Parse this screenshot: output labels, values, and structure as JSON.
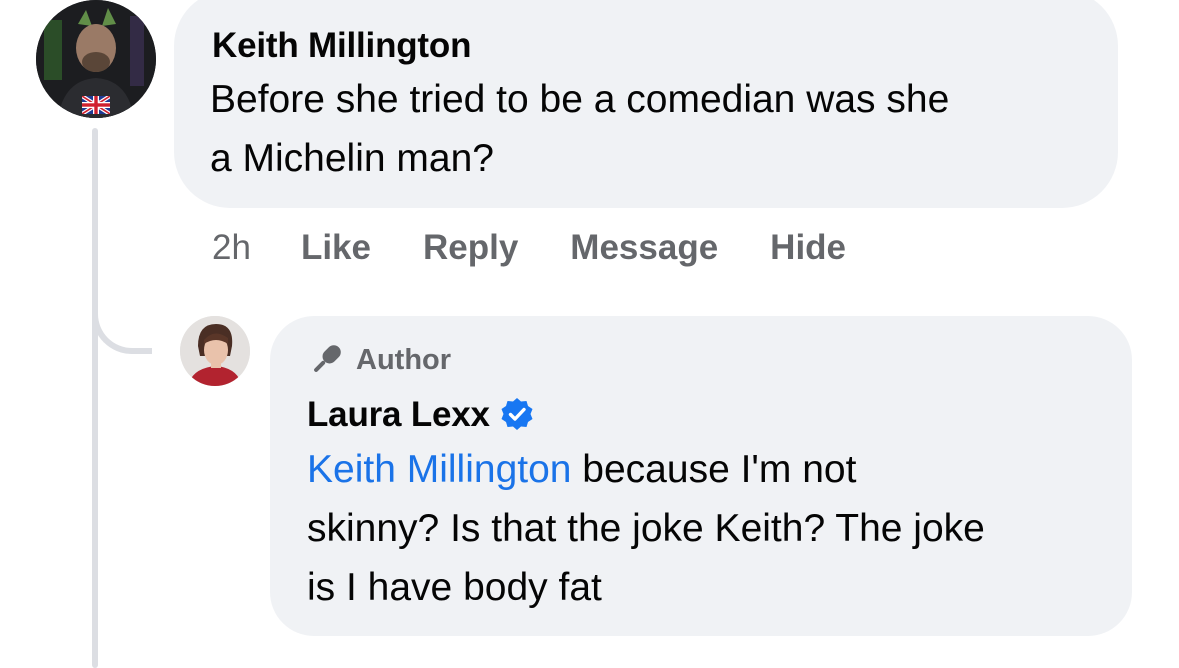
{
  "colors": {
    "bubble_bg": "#f0f2f5",
    "meta_text": "#65676b",
    "link": "#1a73e8",
    "verified_badge": "#1877f2",
    "thread_line": "#dcdee3"
  },
  "comment": {
    "author": "Keith Millington",
    "text_line_1": "Before she tried to be a comedian was she",
    "text_line_2": "a Michelin man?",
    "flag_icon": "uk-flag-icon",
    "actions": {
      "time": "2h",
      "like": "Like",
      "reply": "Reply",
      "message": "Message",
      "hide": "Hide"
    }
  },
  "reply": {
    "badge_label": "Author",
    "badge_icon": "microphone-icon",
    "author": "Laura Lexx",
    "verified_icon": "verified-badge-icon",
    "mention": "Keith Millington",
    "text_line_1_rest": " because I'm not",
    "text_line_2": "skinny? Is that the joke Keith? The joke",
    "text_line_3": "is I have body fat"
  }
}
